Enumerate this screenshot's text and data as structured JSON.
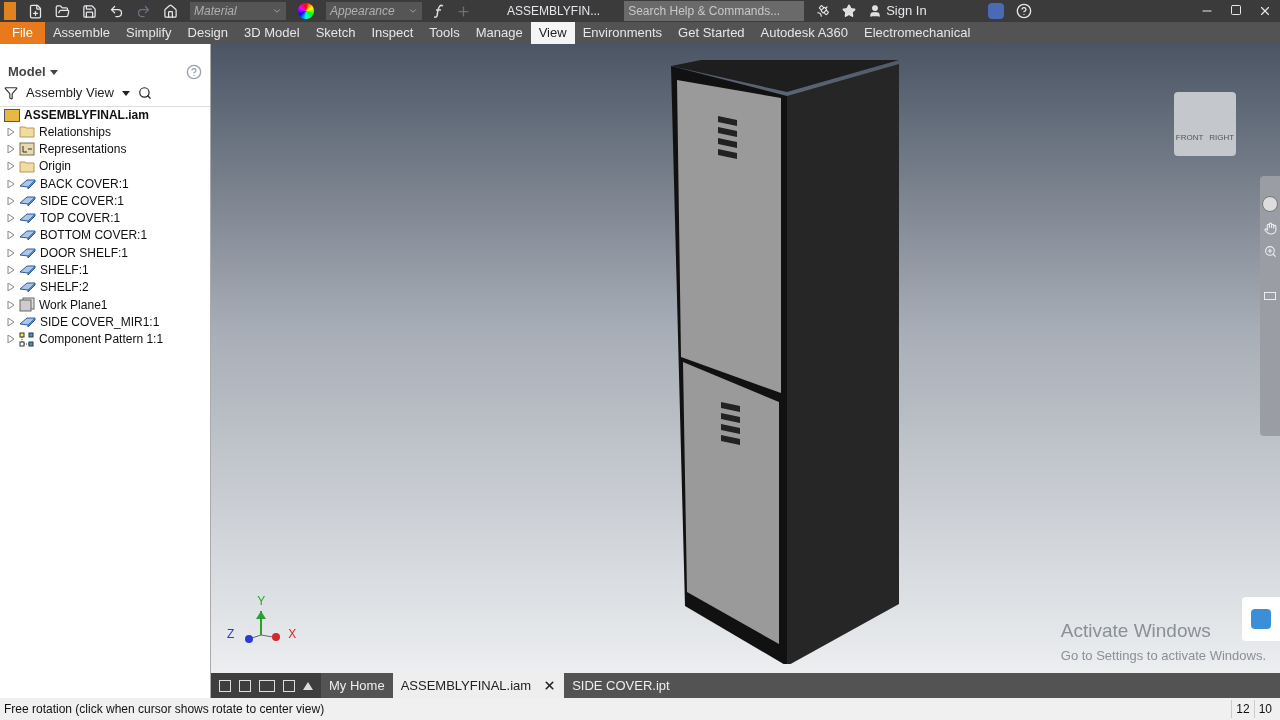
{
  "title_bar": {
    "material_placeholder": "Material",
    "appearance_placeholder": "Appearance",
    "document_title": "ASSEMBLYFIN...",
    "search_placeholder": "Search Help & Commands...",
    "sign_in": "Sign In"
  },
  "ribbon_tabs": [
    {
      "label": "File",
      "kind": "file",
      "selected": false
    },
    {
      "label": "Assemble",
      "kind": "tab",
      "selected": false
    },
    {
      "label": "Simplify",
      "kind": "tab",
      "selected": false
    },
    {
      "label": "Design",
      "kind": "tab",
      "selected": false
    },
    {
      "label": "3D Model",
      "kind": "tab",
      "selected": false
    },
    {
      "label": "Sketch",
      "kind": "tab",
      "selected": false
    },
    {
      "label": "Inspect",
      "kind": "tab",
      "selected": false
    },
    {
      "label": "Tools",
      "kind": "tab",
      "selected": false
    },
    {
      "label": "Manage",
      "kind": "tab",
      "selected": false
    },
    {
      "label": "View",
      "kind": "tab",
      "selected": true
    },
    {
      "label": "Environments",
      "kind": "tab",
      "selected": false
    },
    {
      "label": "Get Started",
      "kind": "tab",
      "selected": false
    },
    {
      "label": "Autodesk A360",
      "kind": "tab",
      "selected": false
    },
    {
      "label": "Electromechanical",
      "kind": "tab",
      "selected": false
    }
  ],
  "browser": {
    "title": "Model",
    "view_selector": "Assembly View",
    "root": {
      "label": "ASSEMBLYFINAL.iam",
      "expanded": true,
      "children": [
        {
          "label": "Relationships",
          "kind": "folder",
          "expanded": false
        },
        {
          "label": "Representations",
          "kind": "representations",
          "expanded": false
        },
        {
          "label": "Origin",
          "kind": "folder",
          "expanded": false
        },
        {
          "label": "BACK COVER:1",
          "kind": "part",
          "expanded": false
        },
        {
          "label": "SIDE COVER:1",
          "kind": "part",
          "expanded": false
        },
        {
          "label": "TOP COVER:1",
          "kind": "part",
          "expanded": false
        },
        {
          "label": "BOTTOM COVER:1",
          "kind": "part",
          "expanded": false
        },
        {
          "label": "DOOR SHELF:1",
          "kind": "part",
          "expanded": false
        },
        {
          "label": "SHELF:1",
          "kind": "part",
          "expanded": false
        },
        {
          "label": "SHELF:2",
          "kind": "part",
          "expanded": false
        },
        {
          "label": "Work Plane1",
          "kind": "plane",
          "expanded": false
        },
        {
          "label": "SIDE COVER_MIR1:1",
          "kind": "part",
          "expanded": false
        },
        {
          "label": "Component Pattern 1:1",
          "kind": "pattern",
          "expanded": false
        }
      ]
    }
  },
  "viewport": {
    "viewcube_faces": [
      "FRONT",
      "RIGHT"
    ],
    "axes": [
      "Y",
      "Z",
      "X"
    ],
    "activation_notice": {
      "title": "Activate Windows",
      "text": "Go to Settings to activate Windows."
    }
  },
  "document_tabs": [
    {
      "label": "My Home",
      "selected": false,
      "closable": false
    },
    {
      "label": "ASSEMBLYFINAL.iam",
      "selected": true,
      "closable": true
    },
    {
      "label": "SIDE COVER.ipt",
      "selected": false,
      "closable": false
    }
  ],
  "status_bar": {
    "message": "Free rotation (click when cursor shows rotate to center view)",
    "counts": [
      "12",
      "10"
    ]
  }
}
